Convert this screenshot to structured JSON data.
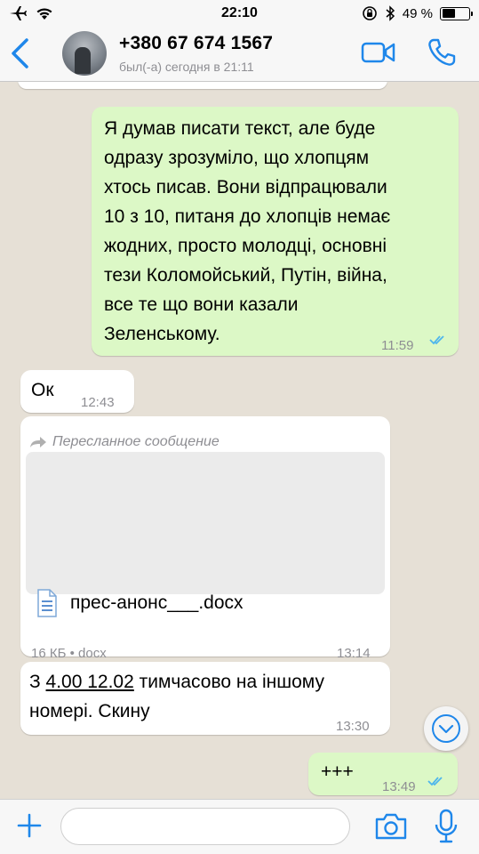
{
  "status_bar": {
    "time": "22:10",
    "battery_text": "49 %",
    "battery_level_percent": 49,
    "icons": [
      "airplane-icon",
      "wifi-icon",
      "orientation-lock-icon",
      "bluetooth-icon",
      "battery-icon"
    ]
  },
  "header": {
    "contact_name": "+380 67 674 1567",
    "contact_status": "был(-а) сегодня в 21:11",
    "icons": [
      "back-chevron-icon",
      "video-call-icon",
      "phone-icon"
    ]
  },
  "messages": [
    {
      "direction": "out",
      "lines": [
        "Я думав писати текст, але буде",
        "одразу зрозуміло, що хлопцям",
        "хтось писав. Вони відпрацювали",
        "10 з 10, питаня до хлопців немає",
        "жодних, просто молодці, основні",
        "тези Коломойський, Путін, війна,",
        "все те що вони казали",
        "Зеленському."
      ],
      "time": "11:59",
      "status": "read"
    },
    {
      "direction": "in",
      "text": "Ок",
      "time": "12:43"
    },
    {
      "direction": "in",
      "forwarded_label": "Пересланное сообщение",
      "file_name": "прес-анонс___.docx",
      "file_meta": "16 КБ • docx",
      "time": "13:14"
    },
    {
      "direction": "in",
      "line1_prefix": "З ",
      "line1_link": "4.00 12.02",
      "line1_suffix": " тимчасово на іншому",
      "line2": "номері. Скину",
      "time": "13:30"
    },
    {
      "direction": "out",
      "text": "+++",
      "time": "13:49",
      "status": "read"
    }
  ],
  "input_bar": {
    "message_value": "",
    "icons": [
      "plus-icon",
      "camera-icon",
      "microphone-icon"
    ]
  },
  "colors": {
    "accent": "#1f87ea",
    "outgoing_bubble": "#dcf8c6",
    "incoming_bubble": "#ffffff",
    "read_ticks": "#4fb6ec",
    "chat_background": "#e6e0d6"
  }
}
